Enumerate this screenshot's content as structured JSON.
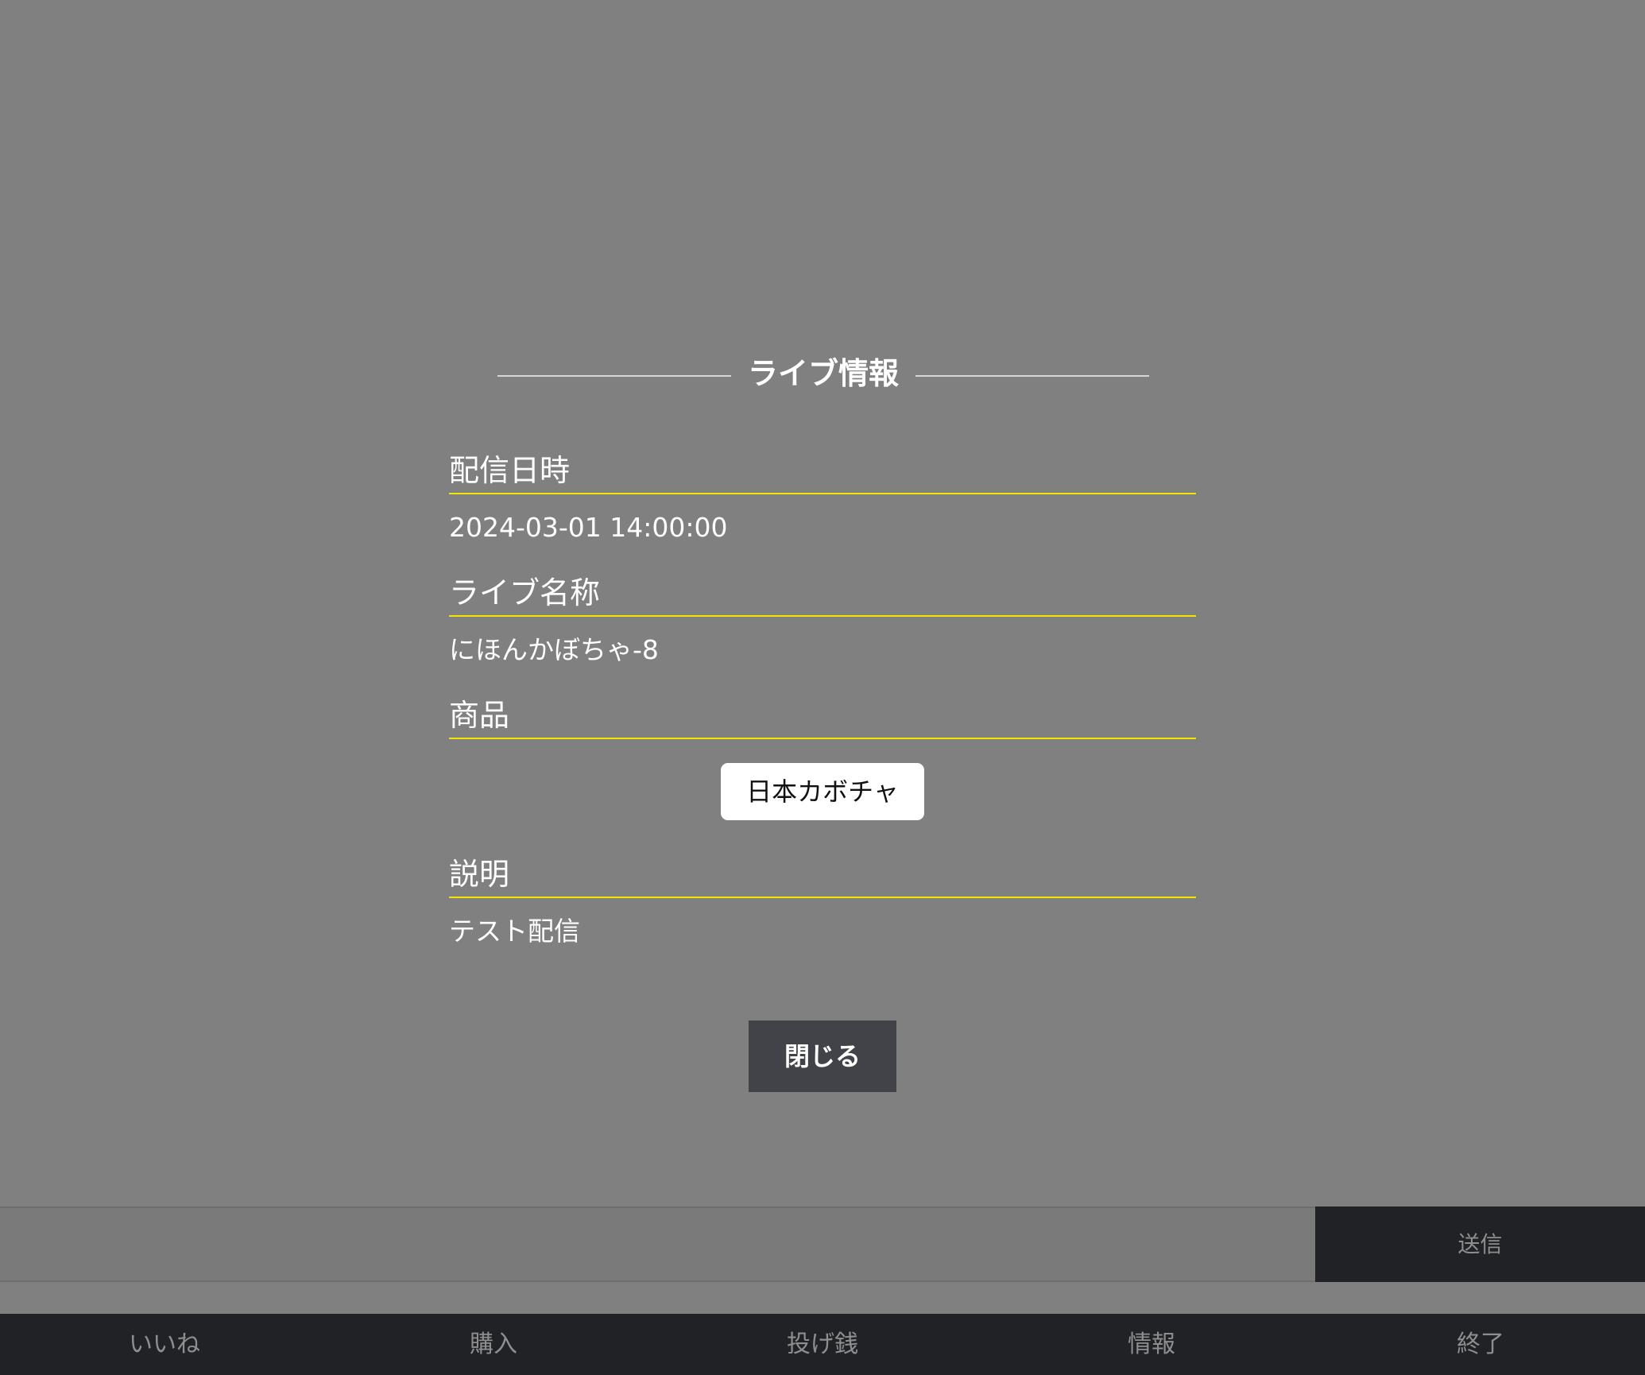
{
  "modal": {
    "title": "ライブ情報",
    "sections": {
      "datetime": {
        "label": "配信日時",
        "value": "2024-03-01 14:00:00"
      },
      "live_name": {
        "label": "ライブ名称",
        "value": "にほんかぼちゃ-8"
      },
      "products": {
        "label": "商品",
        "items": [
          "日本カボチャ"
        ]
      },
      "description": {
        "label": "説明",
        "value": "テスト配信"
      }
    },
    "close_label": "閉じる"
  },
  "comment_bar": {
    "input_value": "",
    "send_label": "送信"
  },
  "bottom_nav": {
    "items": [
      {
        "label": "いいね"
      },
      {
        "label": "購入"
      },
      {
        "label": "投げ銭"
      },
      {
        "label": "情報"
      },
      {
        "label": "終了"
      }
    ]
  },
  "colors": {
    "overlay": "#808080",
    "accent_underline": "#f2e600",
    "button_dark": "#424349",
    "bar_dark": "#212226",
    "muted_text": "#8e8e8e"
  }
}
